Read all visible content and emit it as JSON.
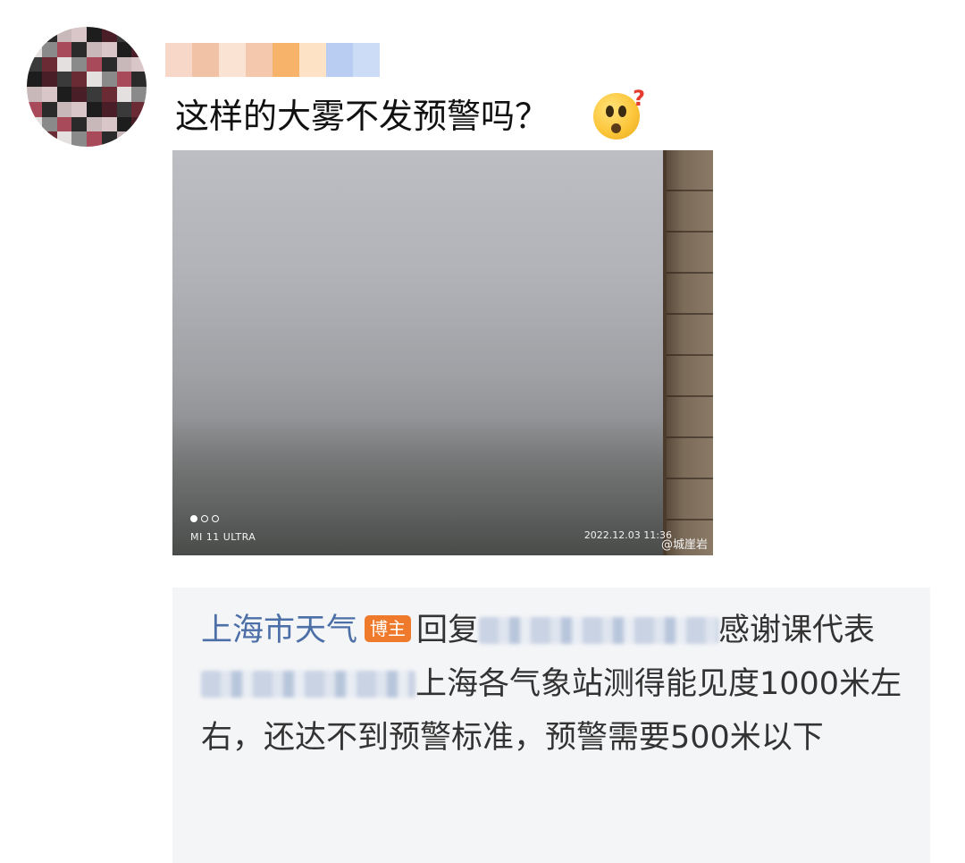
{
  "post": {
    "text": "这样的大雾不发预警吗？",
    "emoji": "thinking-question-emoji"
  },
  "photo": {
    "camera_label": "MI 11 ULTRA",
    "timestamp": "2022.12.03  11:36",
    "watermark": "@城崖岩",
    "carousel_pages": 3,
    "carousel_active": 1
  },
  "reply": {
    "author": "上海市天气",
    "badge": "博主",
    "reply_prefix": "回复",
    "reply_suffix": "感谢课代表",
    "body": "上海各气象站测得能见度1000米左右，还达不到预警标准，预警需要500米以下"
  },
  "colors": {
    "author_link": "#4c6fa8",
    "badge_bg": "#f07a2c",
    "reply_bg": "#f4f5f7"
  }
}
